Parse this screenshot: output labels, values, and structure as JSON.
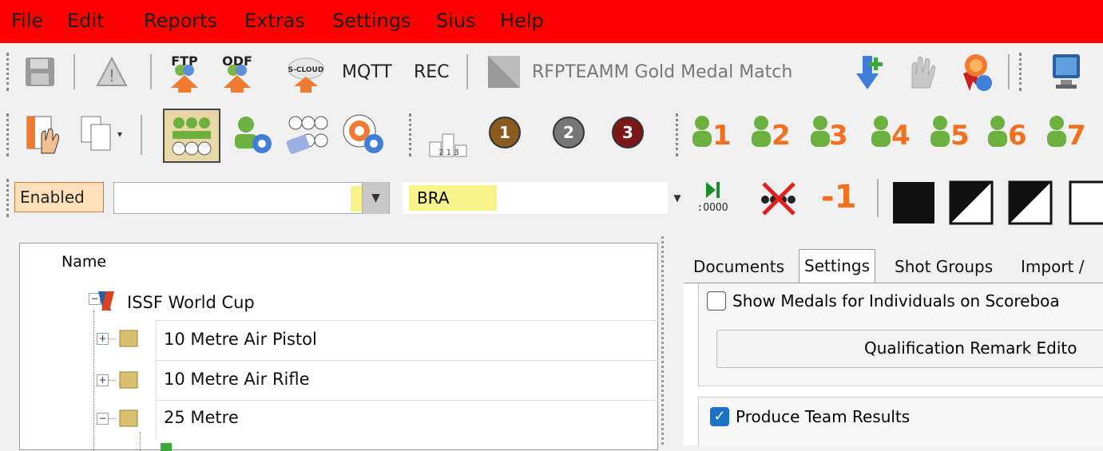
{
  "menu": [
    "File",
    "Edit",
    "Reports",
    "Extras",
    "Settings",
    "Sius",
    "Help"
  ],
  "toolbar1": {
    "ftp_label": "FTP",
    "odf_label": "ODF",
    "scloud_label": "S-CLOUD",
    "mqtt_label": "MQTT",
    "rec_label": "REC",
    "match_label": "RFPTEAMM Gold Medal Match"
  },
  "toolbar2": {
    "medals": [
      "1",
      "2",
      "3"
    ],
    "medal_colors": [
      "#8a5a20",
      "#777777",
      "#7a1818"
    ],
    "positions": [
      "1",
      "2",
      "3",
      "4",
      "5",
      "6",
      "7"
    ],
    "podium_text": "2 1 3"
  },
  "toolbar3": {
    "enabled_label": "Enabled",
    "combo1_value": "",
    "combo2_value": "BRA",
    "minus_one": "-1",
    "ooooo": ":OOOO"
  },
  "tree": {
    "header": "Name",
    "root": "ISSF World Cup",
    "children": [
      "10 Metre Air Pistol",
      "10 Metre Air Rifle",
      "25 Metre"
    ]
  },
  "right_panel": {
    "tabs": [
      "Documents",
      "Settings",
      "Shot Groups",
      "Import /"
    ],
    "active_tab": "Settings",
    "show_medals_label": "Show Medals for Individuals on Scoreboa",
    "qual_button": "Qualification Remark Edito",
    "produce_team_label": "Produce Team Results"
  }
}
